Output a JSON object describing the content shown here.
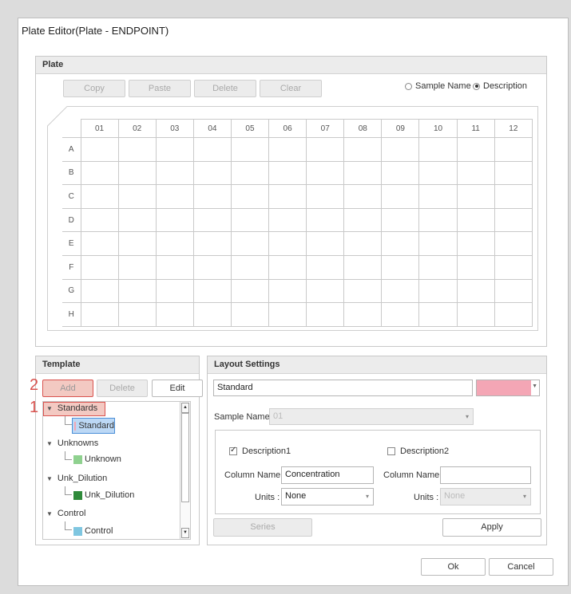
{
  "window": {
    "title": "Plate Editor(Plate - ENDPOINT)"
  },
  "plate": {
    "header": "Plate",
    "toolbar": {
      "copy": "Copy",
      "paste": "Paste",
      "delete": "Delete",
      "clear": "Clear"
    },
    "display_mode": {
      "sample_name": "Sample Name",
      "description": "Description",
      "selected": "Description"
    },
    "columns": [
      "01",
      "02",
      "03",
      "04",
      "05",
      "06",
      "07",
      "08",
      "09",
      "10",
      "11",
      "12"
    ],
    "rows": [
      "A",
      "B",
      "C",
      "D",
      "E",
      "F",
      "G",
      "H"
    ]
  },
  "template": {
    "header": "Template",
    "add": "Add",
    "delete": "Delete",
    "edit": "Edit",
    "annotations": {
      "one": "1",
      "two": "2"
    },
    "groups": [
      {
        "label": "Standards",
        "child": "Standard",
        "color": "#f4a6b5"
      },
      {
        "label": "Unknowns",
        "child": "Unknown",
        "color": "#8fd18f"
      },
      {
        "label": "Unk_Dilution",
        "child": "Unk_Dilution",
        "color": "#2f8a3a"
      },
      {
        "label": "Control",
        "child": "Control",
        "color": "#7fc6e0"
      }
    ]
  },
  "layout": {
    "header": "Layout Settings",
    "name_value": "Standard",
    "color": "#f4a6b5",
    "sample_name_label": "Sample Name :",
    "sample_name_value": "01",
    "desc1_label": "Description1",
    "desc1_checked": true,
    "desc2_label": "Description2",
    "desc2_checked": false,
    "col_name_label": "Column Name :",
    "col_name_1": "Concentration",
    "col_name_2": "",
    "units_label": "Units :",
    "units_1": "None",
    "units_2": "None",
    "series": "Series",
    "apply": "Apply"
  },
  "footer": {
    "ok": "Ok",
    "cancel": "Cancel"
  }
}
